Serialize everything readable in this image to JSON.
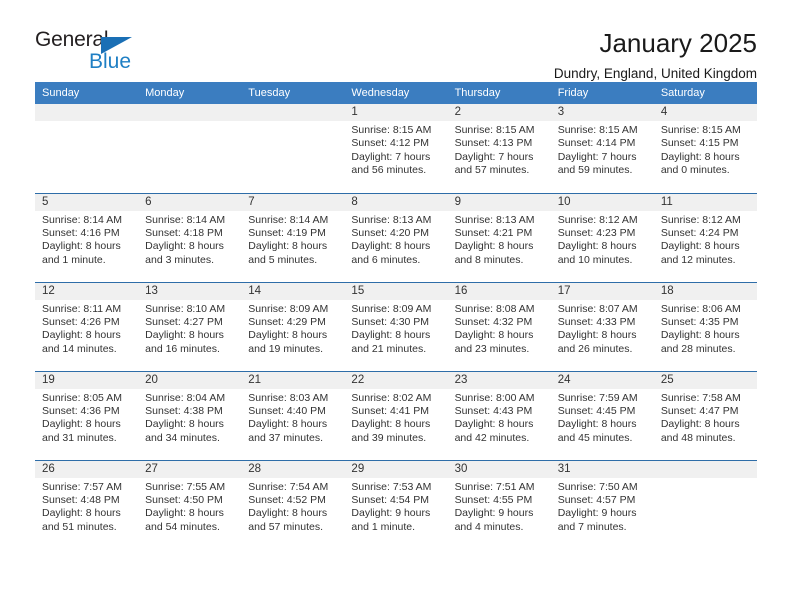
{
  "brand": {
    "name_top": "General",
    "name_bottom": "Blue",
    "accent_color": "#1f7fc4",
    "triangle_color": "#1a6fb5"
  },
  "header": {
    "title": "January 2025",
    "subtitle": "Dundry, England, United Kingdom"
  },
  "theme": {
    "header_row_bg": "#3b7dc0",
    "row_divider": "#2e6da8",
    "daynum_band_bg": "#f0f0f0",
    "text_color": "#333333"
  },
  "weekday_headers": [
    "Sunday",
    "Monday",
    "Tuesday",
    "Wednesday",
    "Thursday",
    "Friday",
    "Saturday"
  ],
  "weeks": [
    [
      {
        "day": "",
        "lines": []
      },
      {
        "day": "",
        "lines": []
      },
      {
        "day": "",
        "lines": []
      },
      {
        "day": "1",
        "lines": [
          "Sunrise: 8:15 AM",
          "Sunset: 4:12 PM",
          "Daylight: 7 hours",
          "and 56 minutes."
        ]
      },
      {
        "day": "2",
        "lines": [
          "Sunrise: 8:15 AM",
          "Sunset: 4:13 PM",
          "Daylight: 7 hours",
          "and 57 minutes."
        ]
      },
      {
        "day": "3",
        "lines": [
          "Sunrise: 8:15 AM",
          "Sunset: 4:14 PM",
          "Daylight: 7 hours",
          "and 59 minutes."
        ]
      },
      {
        "day": "4",
        "lines": [
          "Sunrise: 8:15 AM",
          "Sunset: 4:15 PM",
          "Daylight: 8 hours",
          "and 0 minutes."
        ]
      }
    ],
    [
      {
        "day": "5",
        "lines": [
          "Sunrise: 8:14 AM",
          "Sunset: 4:16 PM",
          "Daylight: 8 hours",
          "and 1 minute."
        ]
      },
      {
        "day": "6",
        "lines": [
          "Sunrise: 8:14 AM",
          "Sunset: 4:18 PM",
          "Daylight: 8 hours",
          "and 3 minutes."
        ]
      },
      {
        "day": "7",
        "lines": [
          "Sunrise: 8:14 AM",
          "Sunset: 4:19 PM",
          "Daylight: 8 hours",
          "and 5 minutes."
        ]
      },
      {
        "day": "8",
        "lines": [
          "Sunrise: 8:13 AM",
          "Sunset: 4:20 PM",
          "Daylight: 8 hours",
          "and 6 minutes."
        ]
      },
      {
        "day": "9",
        "lines": [
          "Sunrise: 8:13 AM",
          "Sunset: 4:21 PM",
          "Daylight: 8 hours",
          "and 8 minutes."
        ]
      },
      {
        "day": "10",
        "lines": [
          "Sunrise: 8:12 AM",
          "Sunset: 4:23 PM",
          "Daylight: 8 hours",
          "and 10 minutes."
        ]
      },
      {
        "day": "11",
        "lines": [
          "Sunrise: 8:12 AM",
          "Sunset: 4:24 PM",
          "Daylight: 8 hours",
          "and 12 minutes."
        ]
      }
    ],
    [
      {
        "day": "12",
        "lines": [
          "Sunrise: 8:11 AM",
          "Sunset: 4:26 PM",
          "Daylight: 8 hours",
          "and 14 minutes."
        ]
      },
      {
        "day": "13",
        "lines": [
          "Sunrise: 8:10 AM",
          "Sunset: 4:27 PM",
          "Daylight: 8 hours",
          "and 16 minutes."
        ]
      },
      {
        "day": "14",
        "lines": [
          "Sunrise: 8:09 AM",
          "Sunset: 4:29 PM",
          "Daylight: 8 hours",
          "and 19 minutes."
        ]
      },
      {
        "day": "15",
        "lines": [
          "Sunrise: 8:09 AM",
          "Sunset: 4:30 PM",
          "Daylight: 8 hours",
          "and 21 minutes."
        ]
      },
      {
        "day": "16",
        "lines": [
          "Sunrise: 8:08 AM",
          "Sunset: 4:32 PM",
          "Daylight: 8 hours",
          "and 23 minutes."
        ]
      },
      {
        "day": "17",
        "lines": [
          "Sunrise: 8:07 AM",
          "Sunset: 4:33 PM",
          "Daylight: 8 hours",
          "and 26 minutes."
        ]
      },
      {
        "day": "18",
        "lines": [
          "Sunrise: 8:06 AM",
          "Sunset: 4:35 PM",
          "Daylight: 8 hours",
          "and 28 minutes."
        ]
      }
    ],
    [
      {
        "day": "19",
        "lines": [
          "Sunrise: 8:05 AM",
          "Sunset: 4:36 PM",
          "Daylight: 8 hours",
          "and 31 minutes."
        ]
      },
      {
        "day": "20",
        "lines": [
          "Sunrise: 8:04 AM",
          "Sunset: 4:38 PM",
          "Daylight: 8 hours",
          "and 34 minutes."
        ]
      },
      {
        "day": "21",
        "lines": [
          "Sunrise: 8:03 AM",
          "Sunset: 4:40 PM",
          "Daylight: 8 hours",
          "and 37 minutes."
        ]
      },
      {
        "day": "22",
        "lines": [
          "Sunrise: 8:02 AM",
          "Sunset: 4:41 PM",
          "Daylight: 8 hours",
          "and 39 minutes."
        ]
      },
      {
        "day": "23",
        "lines": [
          "Sunrise: 8:00 AM",
          "Sunset: 4:43 PM",
          "Daylight: 8 hours",
          "and 42 minutes."
        ]
      },
      {
        "day": "24",
        "lines": [
          "Sunrise: 7:59 AM",
          "Sunset: 4:45 PM",
          "Daylight: 8 hours",
          "and 45 minutes."
        ]
      },
      {
        "day": "25",
        "lines": [
          "Sunrise: 7:58 AM",
          "Sunset: 4:47 PM",
          "Daylight: 8 hours",
          "and 48 minutes."
        ]
      }
    ],
    [
      {
        "day": "26",
        "lines": [
          "Sunrise: 7:57 AM",
          "Sunset: 4:48 PM",
          "Daylight: 8 hours",
          "and 51 minutes."
        ]
      },
      {
        "day": "27",
        "lines": [
          "Sunrise: 7:55 AM",
          "Sunset: 4:50 PM",
          "Daylight: 8 hours",
          "and 54 minutes."
        ]
      },
      {
        "day": "28",
        "lines": [
          "Sunrise: 7:54 AM",
          "Sunset: 4:52 PM",
          "Daylight: 8 hours",
          "and 57 minutes."
        ]
      },
      {
        "day": "29",
        "lines": [
          "Sunrise: 7:53 AM",
          "Sunset: 4:54 PM",
          "Daylight: 9 hours",
          "and 1 minute."
        ]
      },
      {
        "day": "30",
        "lines": [
          "Sunrise: 7:51 AM",
          "Sunset: 4:55 PM",
          "Daylight: 9 hours",
          "and 4 minutes."
        ]
      },
      {
        "day": "31",
        "lines": [
          "Sunrise: 7:50 AM",
          "Sunset: 4:57 PM",
          "Daylight: 9 hours",
          "and 7 minutes."
        ]
      },
      {
        "day": "",
        "lines": []
      }
    ]
  ]
}
